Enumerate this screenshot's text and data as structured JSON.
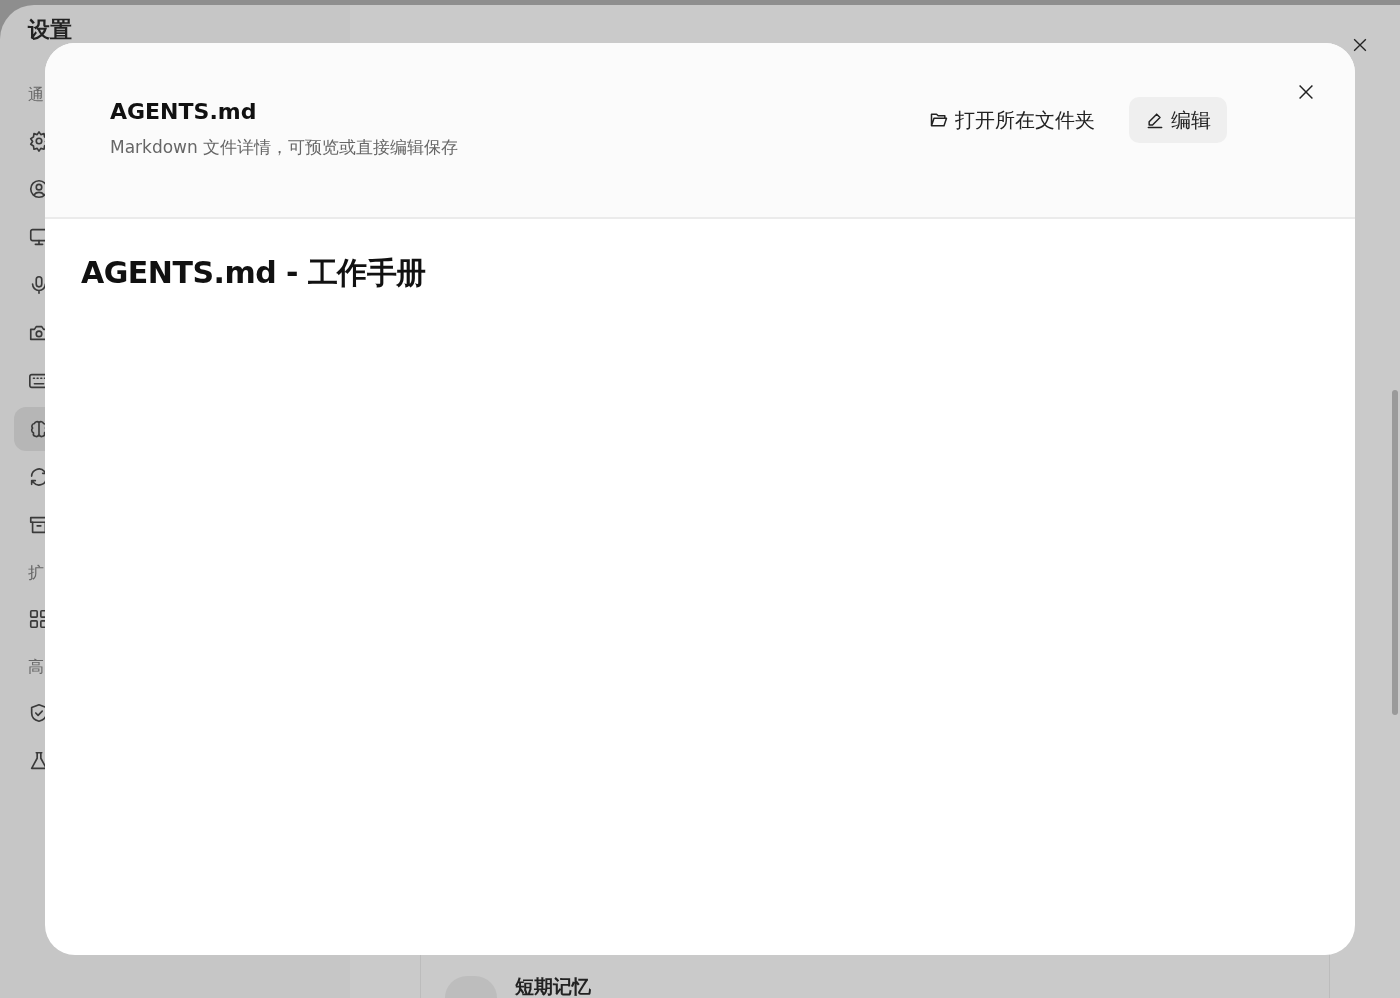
{
  "settings_window": {
    "title": "设置",
    "sidebar": [
      {
        "label": "通",
        "items": [
          {
            "kind": "gear",
            "selected": false
          },
          {
            "kind": "user",
            "selected": false
          },
          {
            "kind": "monitor",
            "selected": false
          },
          {
            "kind": "mic",
            "selected": false
          },
          {
            "kind": "camera",
            "selected": false
          },
          {
            "kind": "keyboard",
            "selected": false
          },
          {
            "kind": "brain",
            "selected": true
          },
          {
            "kind": "sync",
            "selected": false
          },
          {
            "kind": "archive",
            "selected": false
          }
        ]
      },
      {
        "label": "扩",
        "items": [
          {
            "kind": "grid",
            "selected": false
          }
        ]
      },
      {
        "label": "高",
        "items": [
          {
            "kind": "shield",
            "selected": false
          },
          {
            "kind": "flask",
            "selected": false
          }
        ]
      }
    ],
    "list_item": {
      "title": "短期记忆"
    }
  },
  "dialog": {
    "title": "AGENTS.md",
    "subtitle": "Markdown 文件详情，可预览或直接编辑保存",
    "actions": [
      {
        "kind": "folder",
        "label": "打开所在文件夹"
      },
      {
        "kind": "edit",
        "label": "编辑"
      }
    ],
    "heading": "AGENTS.md - 工作手册"
  }
}
